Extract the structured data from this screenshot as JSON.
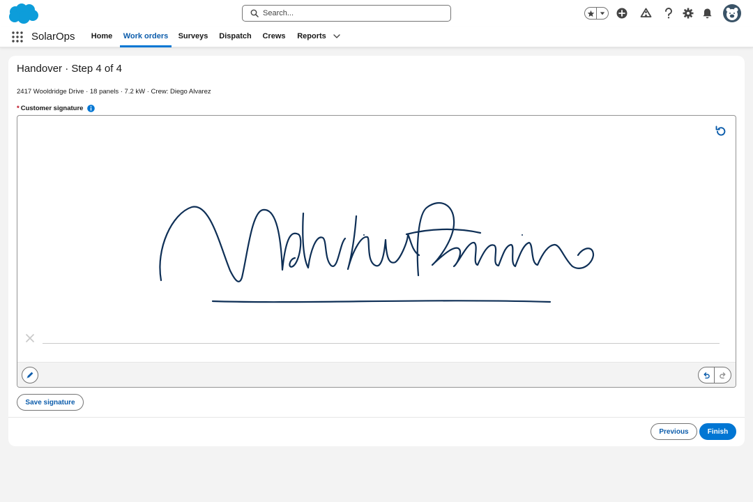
{
  "header": {
    "logo_icon": "salesforce-cloud-icon",
    "search_placeholder": "Search...",
    "icons": [
      "favorites-star-icon",
      "chevron-down-icon",
      "global-add-icon",
      "trailhead-icon",
      "help-icon",
      "setup-gear-icon",
      "notifications-bell-icon",
      "user-avatar"
    ]
  },
  "nav": {
    "app_name": "SolarOps",
    "tabs": [
      {
        "label": "Home",
        "active": false
      },
      {
        "label": "Work orders",
        "active": true
      },
      {
        "label": "Surveys",
        "active": false
      },
      {
        "label": "Dispatch",
        "active": false
      },
      {
        "label": "Crews",
        "active": false
      },
      {
        "label": "Reports",
        "active": false
      }
    ]
  },
  "card": {
    "title": "Handover · Step 4 of 4",
    "summary": "2417 Wooldridge Drive · 18 panels · 7.2 kW · Crew: Diego Alvarez",
    "signature_label": "Customer signature",
    "required_marker": "*",
    "save_signature": "Save signature",
    "previous": "Previous",
    "finish": "Finish"
  },
  "colors": {
    "brand": "#0176d3",
    "active_tab": "#0b5cab",
    "ink": "#0e2f56",
    "required": "#ba0517"
  }
}
